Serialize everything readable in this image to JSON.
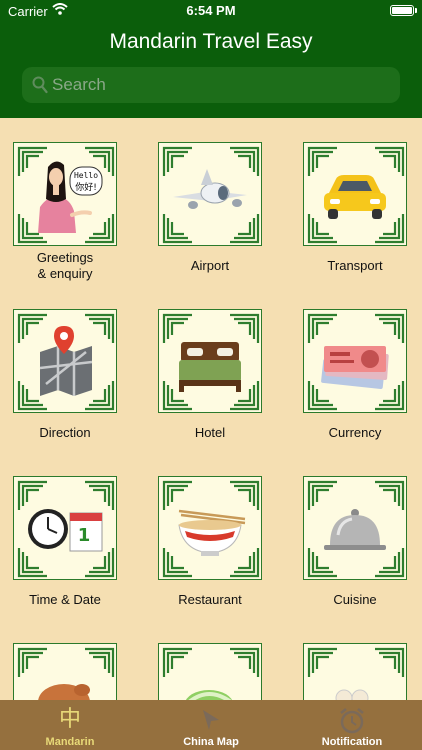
{
  "status": {
    "carrier": "Carrier",
    "time": "6:54 PM"
  },
  "header": {
    "title": "Mandarin Travel Easy"
  },
  "search": {
    "placeholder": "Search"
  },
  "categories": [
    {
      "label": "Greetings\n& enquiry",
      "icon": "woman-hello-icon",
      "speech": "Hello\n你好!"
    },
    {
      "label": "Airport",
      "icon": "airplane-icon"
    },
    {
      "label": "Transport",
      "icon": "taxi-icon"
    },
    {
      "label": "Direction",
      "icon": "map-pin-icon"
    },
    {
      "label": "Hotel",
      "icon": "bed-icon"
    },
    {
      "label": "Currency",
      "icon": "banknotes-icon"
    },
    {
      "label": "Time & Date",
      "icon": "clock-calendar-icon",
      "calendar_day": "1"
    },
    {
      "label": "Restaurant",
      "icon": "noodle-bowl-icon"
    },
    {
      "label": "Cuisine",
      "icon": "cloche-icon"
    },
    {
      "label": "",
      "icon": "roast-chicken-icon"
    },
    {
      "label": "",
      "icon": "cabbage-icon"
    },
    {
      "label": "",
      "icon": "dim-sum-icon"
    }
  ],
  "tabs": [
    {
      "label": "Mandarin",
      "icon": "zhong-character-icon",
      "glyph": "中",
      "active": true
    },
    {
      "label": "China Map",
      "icon": "location-arrow-icon",
      "active": false
    },
    {
      "label": "Notification",
      "icon": "alarm-clock-icon",
      "active": false
    }
  ],
  "colors": {
    "header": "#0b5e0b",
    "background": "#f5dfb2",
    "tabbar": "#95703e",
    "tile_border": "#2b7a2b",
    "active_tab": "#e8d978"
  }
}
